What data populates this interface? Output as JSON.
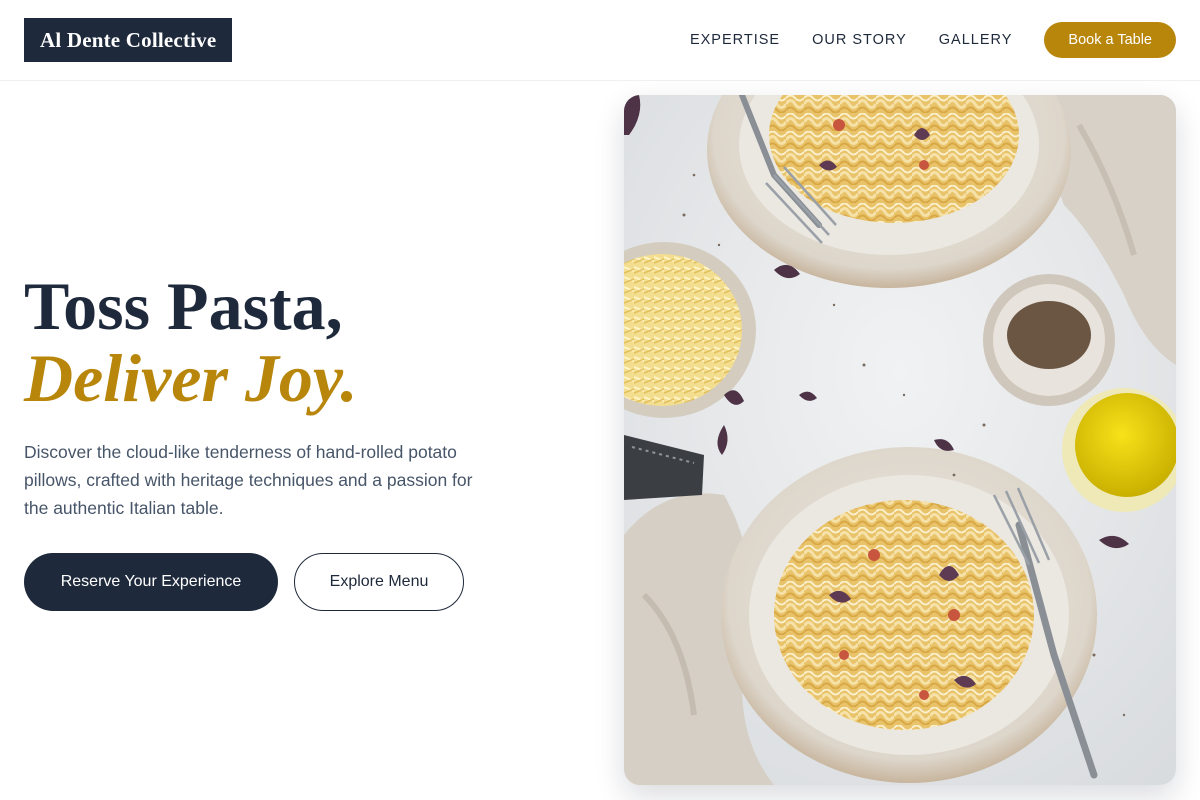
{
  "header": {
    "logo": "Al Dente Collective",
    "nav": [
      "EXPERTISE",
      "OUR STORY",
      "GALLERY"
    ],
    "cta": "Book a Table"
  },
  "hero": {
    "title_line1": "Toss Pasta,",
    "title_line2": "Deliver Joy.",
    "description": "Discover the cloud-like tenderness of hand-rolled potato pillows, crafted with heritage techniques and a passion for the authentic Italian table.",
    "primary_button": "Reserve Your Experience",
    "secondary_button": "Explore Menu",
    "image_alt": "Overhead photo of two bowls of creamy pasta with basil, grated cheese, ground pepper and olive oil"
  },
  "colors": {
    "navy": "#1e293b",
    "gold": "#b8860b",
    "text_muted": "#475569"
  },
  "icons": {
    "hero_image": "pasta-photo"
  }
}
